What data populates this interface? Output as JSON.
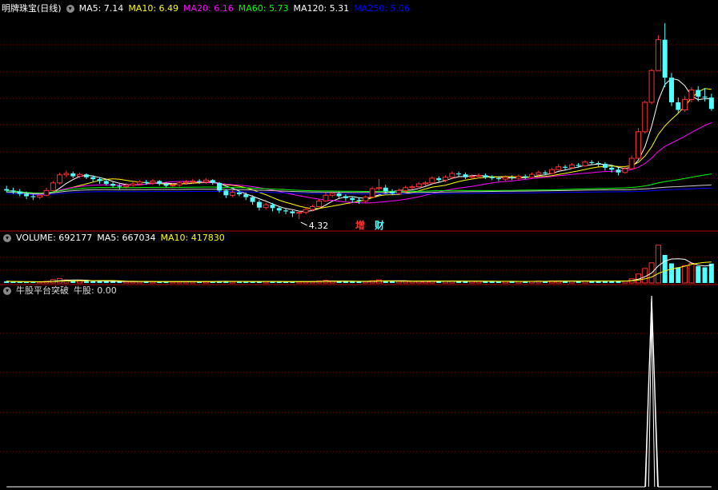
{
  "main": {
    "title": "明牌珠宝(日线)",
    "ma_labels": [
      {
        "text": "MA5: 7.14",
        "color": "#ffffff"
      },
      {
        "text": "MA10: 6.49",
        "color": "#ffff00"
      },
      {
        "text": "MA20: 6.16",
        "color": "#ff00ff"
      },
      {
        "text": "MA60: 5.73",
        "color": "#00ff00"
      },
      {
        "text": "MA120: 5.31",
        "color": "#ffffff"
      },
      {
        "text": "MA250: 5.06",
        "color": "#0000ff"
      }
    ],
    "low_label": "4.32",
    "tags": [
      {
        "text": "增",
        "color": "#ff3030"
      },
      {
        "text": "财",
        "color": "#54ffff"
      }
    ]
  },
  "volume": {
    "labels": [
      {
        "text": "VOLUME: 692177",
        "color": "#ffffff"
      },
      {
        "text": "MA5: 667034",
        "color": "#ffffff"
      },
      {
        "text": "MA10: 417830",
        "color": "#ffff00"
      }
    ]
  },
  "indicator": {
    "labels": [
      {
        "text": "牛股平台突破",
        "color": "#ffffff"
      },
      {
        "text": "牛股: 0.00",
        "color": "#ffffff"
      }
    ]
  },
  "colors": {
    "up": "#ff3232",
    "down": "#54ffff",
    "grid": "#7a0000",
    "background": "#000000"
  },
  "chart_data": [
    {
      "type": "candlestick",
      "series": [
        {
          "name": "K",
          "values": [
            [
              4.95,
              4.92,
              5.02,
              4.88
            ],
            [
              4.92,
              4.9,
              4.98,
              4.85
            ],
            [
              4.9,
              4.85,
              4.95,
              4.8
            ],
            [
              4.85,
              4.8,
              4.9,
              4.74
            ],
            [
              4.8,
              4.78,
              4.85,
              4.72
            ],
            [
              4.78,
              4.82,
              4.86,
              4.74
            ],
            [
              4.82,
              4.92,
              4.98,
              4.8
            ],
            [
              4.92,
              5.08,
              5.12,
              4.9
            ],
            [
              5.08,
              5.25,
              5.3,
              5.05
            ],
            [
              5.25,
              5.28,
              5.34,
              5.2
            ],
            [
              5.28,
              5.22,
              5.32,
              5.18
            ],
            [
              5.22,
              5.26,
              5.3,
              5.18
            ],
            [
              5.26,
              5.2,
              5.28,
              5.16
            ],
            [
              5.2,
              5.16,
              5.24,
              5.1
            ],
            [
              5.16,
              5.12,
              5.2,
              5.06
            ],
            [
              5.12,
              5.06,
              5.16,
              5.02
            ],
            [
              5.06,
              5.02,
              5.1,
              4.98
            ],
            [
              5.02,
              5.0,
              5.06,
              4.95
            ],
            [
              5.0,
              5.03,
              5.08,
              4.96
            ],
            [
              5.03,
              5.06,
              5.1,
              5.0
            ],
            [
              5.06,
              5.1,
              5.14,
              5.02
            ],
            [
              5.1,
              5.08,
              5.14,
              5.04
            ],
            [
              5.08,
              5.12,
              5.16,
              5.04
            ],
            [
              5.12,
              5.06,
              5.14,
              5.02
            ],
            [
              5.06,
              5.02,
              5.1,
              4.98
            ],
            [
              5.02,
              5.04,
              5.08,
              4.98
            ],
            [
              5.04,
              5.08,
              5.12,
              5.0
            ],
            [
              5.08,
              5.1,
              5.14,
              5.04
            ],
            [
              5.1,
              5.12,
              5.16,
              5.06
            ],
            [
              5.12,
              5.1,
              5.16,
              5.06
            ],
            [
              5.1,
              5.14,
              5.18,
              5.06
            ],
            [
              5.14,
              5.08,
              5.16,
              5.04
            ],
            [
              5.08,
              4.92,
              5.1,
              4.88
            ],
            [
              4.92,
              4.82,
              4.95,
              4.76
            ],
            [
              4.82,
              4.88,
              4.92,
              4.78
            ],
            [
              4.88,
              4.84,
              4.92,
              4.8
            ],
            [
              4.84,
              4.78,
              4.88,
              4.72
            ],
            [
              4.78,
              4.68,
              4.82,
              4.62
            ],
            [
              4.68,
              4.56,
              4.72,
              4.5
            ],
            [
              4.56,
              4.62,
              4.66,
              4.52
            ],
            [
              4.62,
              4.55,
              4.66,
              4.48
            ],
            [
              4.55,
              4.5,
              4.58,
              4.44
            ],
            [
              4.5,
              4.48,
              4.54,
              4.42
            ],
            [
              4.48,
              4.44,
              4.52,
              4.36
            ],
            [
              4.44,
              4.46,
              4.5,
              4.32
            ],
            [
              4.46,
              4.52,
              4.56,
              4.42
            ],
            [
              4.52,
              4.58,
              4.62,
              4.48
            ],
            [
              4.58,
              4.7,
              4.74,
              4.56
            ],
            [
              4.7,
              4.82,
              4.88,
              4.68
            ],
            [
              4.82,
              4.86,
              4.9,
              4.78
            ],
            [
              4.86,
              4.8,
              4.9,
              4.76
            ],
            [
              4.8,
              4.76,
              4.84,
              4.7
            ],
            [
              4.76,
              4.72,
              4.8,
              4.66
            ],
            [
              4.72,
              4.7,
              4.78,
              4.64
            ],
            [
              4.7,
              4.78,
              4.82,
              4.66
            ],
            [
              4.78,
              4.96,
              5.0,
              4.76
            ],
            [
              4.96,
              4.98,
              5.16,
              4.92
            ],
            [
              4.98,
              4.9,
              5.04,
              4.86
            ],
            [
              4.9,
              4.86,
              4.95,
              4.82
            ],
            [
              4.86,
              4.92,
              4.96,
              4.84
            ],
            [
              4.92,
              4.98,
              5.02,
              4.88
            ],
            [
              4.98,
              5.0,
              5.04,
              4.94
            ],
            [
              5.0,
              5.06,
              5.1,
              4.96
            ],
            [
              5.06,
              5.08,
              5.12,
              5.02
            ],
            [
              5.08,
              5.18,
              5.22,
              5.06
            ],
            [
              5.18,
              5.14,
              5.22,
              5.1
            ],
            [
              5.14,
              5.2,
              5.24,
              5.1
            ],
            [
              5.2,
              5.28,
              5.32,
              5.16
            ],
            [
              5.28,
              5.26,
              5.32,
              5.22
            ],
            [
              5.26,
              5.2,
              5.3,
              5.16
            ],
            [
              5.2,
              5.22,
              5.26,
              5.16
            ],
            [
              5.22,
              5.24,
              5.28,
              5.18
            ],
            [
              5.24,
              5.2,
              5.28,
              5.16
            ],
            [
              5.2,
              5.18,
              5.24,
              5.14
            ],
            [
              5.18,
              5.16,
              5.22,
              5.12
            ],
            [
              5.16,
              5.2,
              5.24,
              5.12
            ],
            [
              5.2,
              5.18,
              5.24,
              5.14
            ],
            [
              5.18,
              5.22,
              5.26,
              5.14
            ],
            [
              5.22,
              5.2,
              5.26,
              5.16
            ],
            [
              5.2,
              5.26,
              5.3,
              5.18
            ],
            [
              5.26,
              5.3,
              5.34,
              5.22
            ],
            [
              5.3,
              5.28,
              5.34,
              5.24
            ],
            [
              5.28,
              5.36,
              5.4,
              5.26
            ],
            [
              5.36,
              5.42,
              5.48,
              5.34
            ],
            [
              5.42,
              5.4,
              5.46,
              5.36
            ],
            [
              5.4,
              5.46,
              5.5,
              5.38
            ],
            [
              5.46,
              5.44,
              5.5,
              5.4
            ],
            [
              5.44,
              5.52,
              5.56,
              5.42
            ],
            [
              5.52,
              5.5,
              5.56,
              5.46
            ],
            [
              5.5,
              5.48,
              5.54,
              5.42
            ],
            [
              5.48,
              5.4,
              5.52,
              5.34
            ],
            [
              5.4,
              5.36,
              5.44,
              5.3
            ],
            [
              5.36,
              5.3,
              5.4,
              5.24
            ],
            [
              5.3,
              5.38,
              5.42,
              5.28
            ],
            [
              5.38,
              5.6,
              5.66,
              5.36
            ],
            [
              5.6,
              6.16,
              6.24,
              5.58
            ],
            [
              6.16,
              6.78,
              6.82,
              6.12
            ],
            [
              6.78,
              7.45,
              7.48,
              6.74
            ],
            [
              7.45,
              8.1,
              8.2,
              7.44
            ],
            [
              8.1,
              7.3,
              8.45,
              7.1
            ],
            [
              7.3,
              6.78,
              7.4,
              6.7
            ],
            [
              6.78,
              6.62,
              6.88,
              6.54
            ],
            [
              6.62,
              6.84,
              6.92,
              6.58
            ],
            [
              6.84,
              7.04,
              7.1,
              6.78
            ],
            [
              7.04,
              6.9,
              7.12,
              6.8
            ],
            [
              6.9,
              6.88,
              7.08,
              6.8
            ],
            [
              6.88,
              6.64,
              6.96,
              6.6
            ]
          ]
        }
      ],
      "ylim": [
        4.1,
        8.6
      ]
    },
    {
      "type": "bar",
      "series": [
        {
          "name": "VOLUME",
          "values": [
            62000,
            48000,
            40000,
            36000,
            38000,
            42000,
            58000,
            120000,
            160000,
            110000,
            82000,
            76000,
            70000,
            66000,
            60000,
            56000,
            52000,
            48000,
            50000,
            52000,
            54000,
            50000,
            52000,
            48000,
            46000,
            47000,
            49000,
            51000,
            52000,
            50000,
            53000,
            58000,
            70000,
            62000,
            48000,
            46000,
            50000,
            58000,
            60000,
            52000,
            52000,
            48000,
            46000,
            50000,
            46000,
            52000,
            58000,
            70000,
            92000,
            70000,
            60000,
            54000,
            50000,
            48000,
            54000,
            78000,
            110000,
            88000,
            66000,
            60000,
            58000,
            56000,
            60000,
            60000,
            70000,
            66000,
            62000,
            72000,
            66000,
            62000,
            60000,
            58000,
            58000,
            56000,
            54000,
            56000,
            54000,
            58000,
            56000,
            60000,
            66000,
            62000,
            70000,
            74000,
            66000,
            70000,
            66000,
            74000,
            70000,
            68000,
            76000,
            70000,
            66000,
            64000,
            150000,
            320000,
            520000,
            720000,
            1350000,
            1000000,
            700000,
            560000,
            620000,
            700000,
            600000,
            560000,
            692177
          ]
        }
      ]
    },
    {
      "type": "line",
      "series": [
        {
          "name": "牛股",
          "values": [
            0,
            0,
            0,
            0,
            0,
            0,
            0,
            0,
            0,
            0,
            0,
            0,
            0,
            0,
            0,
            0,
            0,
            0,
            0,
            0,
            0,
            0,
            0,
            0,
            0,
            0,
            0,
            0,
            0,
            0,
            0,
            0,
            0,
            0,
            0,
            0,
            0,
            0,
            0,
            0,
            0,
            0,
            0,
            0,
            0,
            0,
            0,
            0,
            0,
            0,
            0,
            0,
            0,
            0,
            0,
            0,
            0,
            0,
            0,
            0,
            0,
            0,
            0,
            0,
            0,
            0,
            0,
            0,
            0,
            0,
            0,
            0,
            0,
            0,
            0,
            0,
            0,
            0,
            0,
            0,
            0,
            0,
            0,
            0,
            0,
            0,
            0,
            0,
            0,
            0,
            0,
            0,
            0,
            0,
            0,
            0,
            0,
            1,
            0,
            0,
            0,
            0,
            0,
            0,
            0,
            0,
            0
          ]
        }
      ],
      "ylim": [
        0,
        1
      ]
    }
  ]
}
